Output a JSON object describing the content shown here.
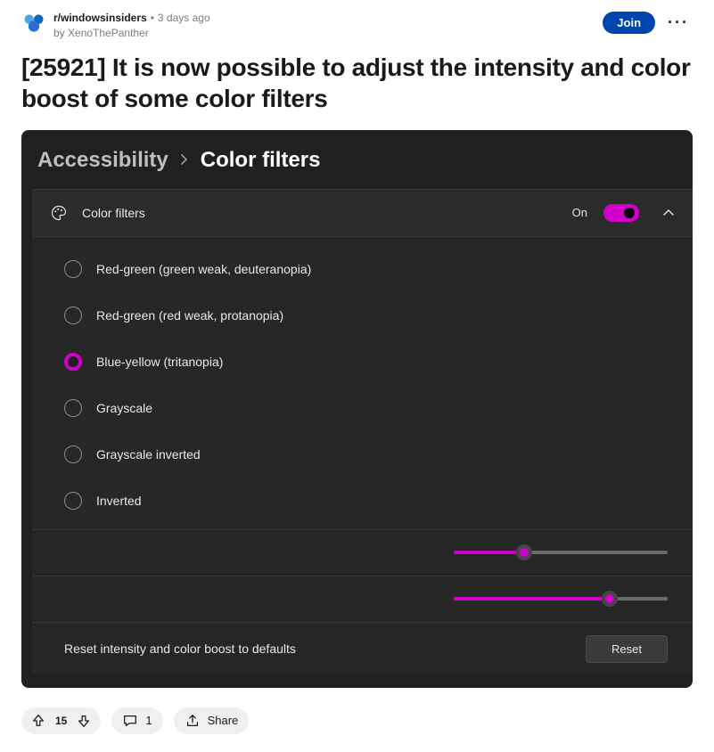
{
  "header": {
    "subreddit": "r/windowsinsiders",
    "time": "3 days ago",
    "author_prefix": "by ",
    "author": "XenoThePanther",
    "join_label": "Join"
  },
  "post": {
    "title": "[25921] It is now possible to adjust the intensity and color boost of some color filters"
  },
  "settings": {
    "breadcrumb_parent": "Accessibility",
    "breadcrumb_current": "Color filters",
    "section_title": "Color filters",
    "toggle_state_label": "On",
    "toggle_on": true,
    "options": [
      {
        "label": "Red-green (green weak, deuteranopia)",
        "selected": false
      },
      {
        "label": "Red-green (red weak, protanopia)",
        "selected": false
      },
      {
        "label": "Blue-yellow (tritanopia)",
        "selected": true
      },
      {
        "label": "Grayscale",
        "selected": false
      },
      {
        "label": "Grayscale inverted",
        "selected": false
      },
      {
        "label": "Inverted",
        "selected": false
      }
    ],
    "slider_intensity_pct": 33,
    "slider_colorboost_pct": 73,
    "reset_description": "Reset intensity and color boost to defaults",
    "reset_button_label": "Reset",
    "accent_color": "#d100c9"
  },
  "actions": {
    "score": "15",
    "comments": "1",
    "share_label": "Share"
  }
}
